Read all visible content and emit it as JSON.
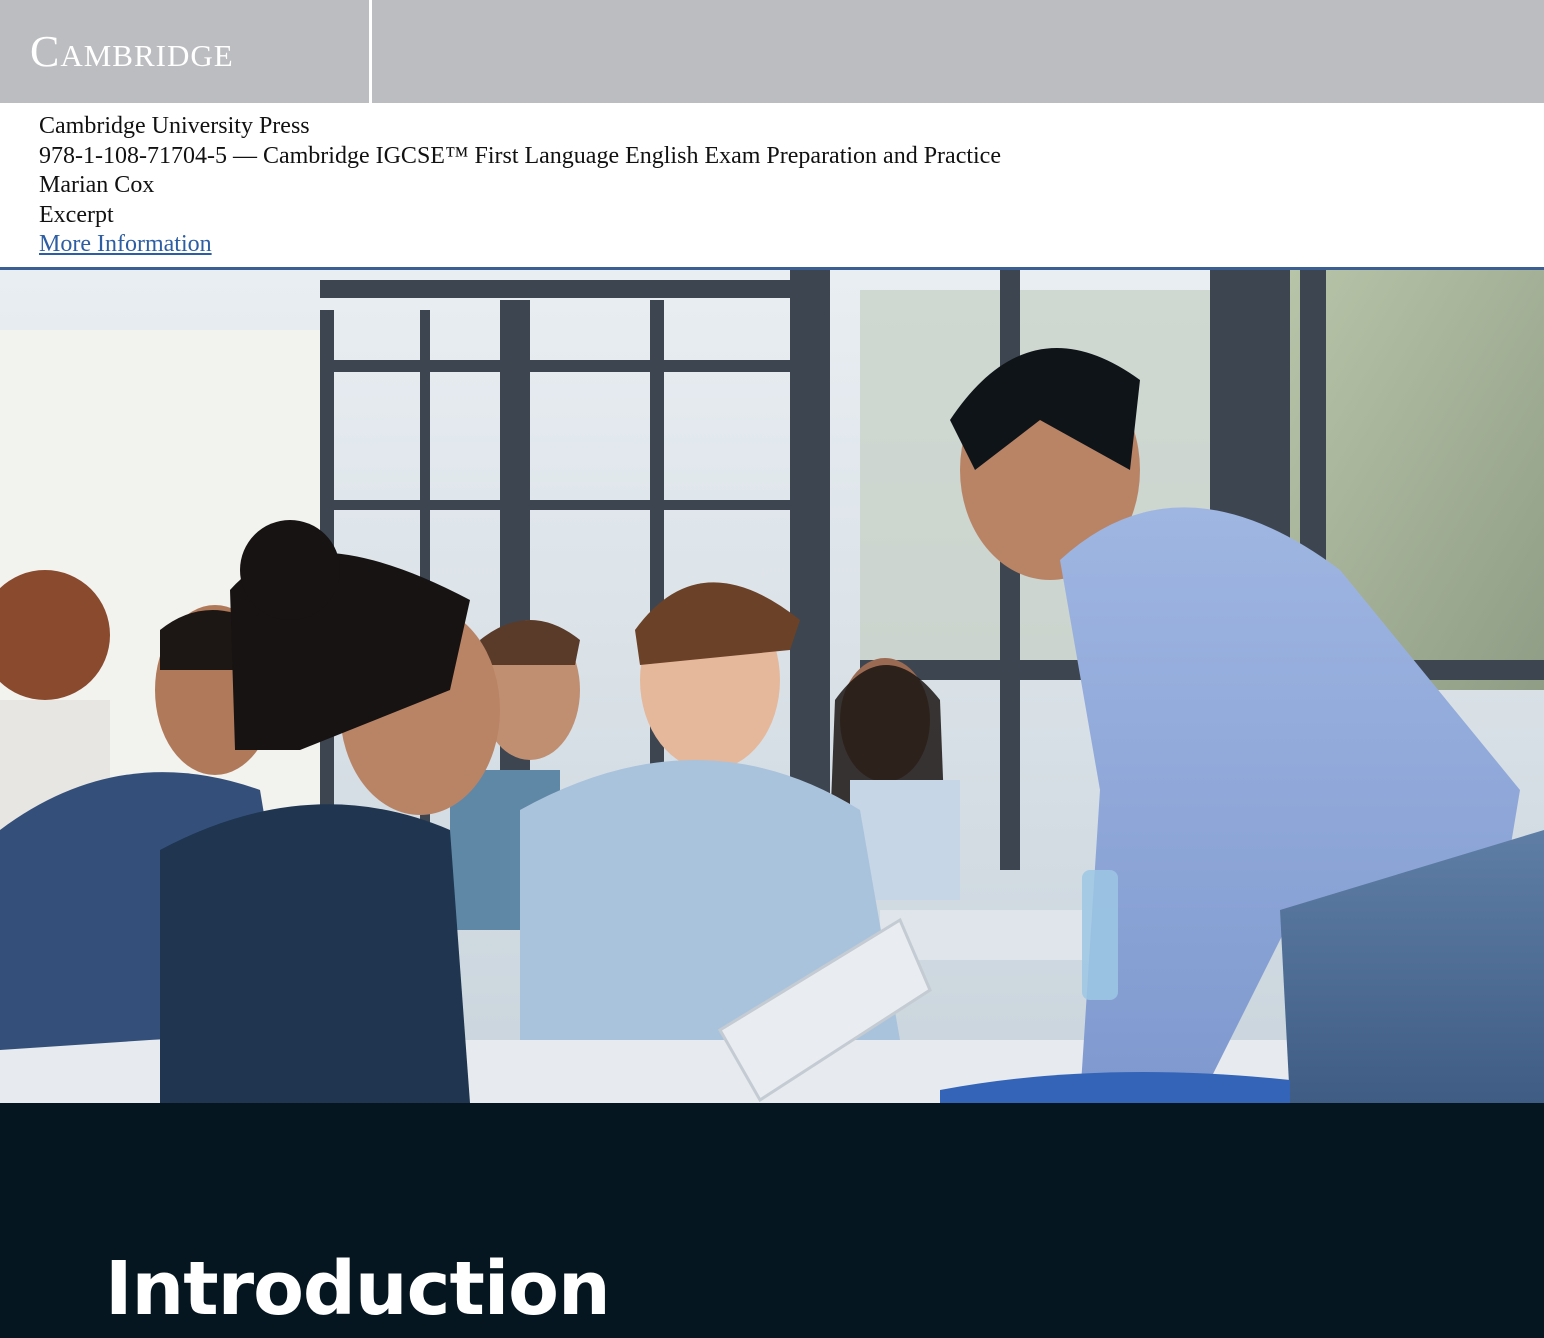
{
  "header": {
    "logo_text": "Cambridge",
    "publisher": "Cambridge University Press",
    "isbn_title": "978-1-108-71704-5 — Cambridge IGCSE™ First Language English Exam Preparation and Practice",
    "author": "Marian Cox",
    "doc_type": "Excerpt",
    "more_info_link": "More Information"
  },
  "photo": {
    "alt": "Students and a teacher smiling around a table with a tablet"
  },
  "section": {
    "heading": "Introduction"
  },
  "colors": {
    "banner": "#bcbdc0",
    "link": "#2d5ea3",
    "rule": "#3b5f93",
    "dark_panel": "#061620"
  }
}
